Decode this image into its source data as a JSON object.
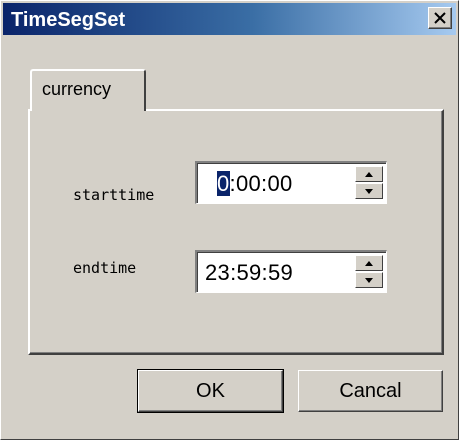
{
  "window": {
    "title": "TimeSegSet",
    "close_icon": "close-icon"
  },
  "tabs": [
    {
      "label": "currency"
    }
  ],
  "fields": {
    "starttime": {
      "label": "starttime",
      "selected_part": "0",
      "rest_value": ":00:00"
    },
    "endtime": {
      "label": "endtime",
      "value": "23:59:59"
    }
  },
  "buttons": {
    "ok_label": "OK",
    "cancel_label": "Cancal"
  },
  "colors": {
    "titlebar_start": "#0a246a",
    "titlebar_end": "#a6caf0",
    "face": "#d4d0c8",
    "selection": "#0a246a"
  }
}
